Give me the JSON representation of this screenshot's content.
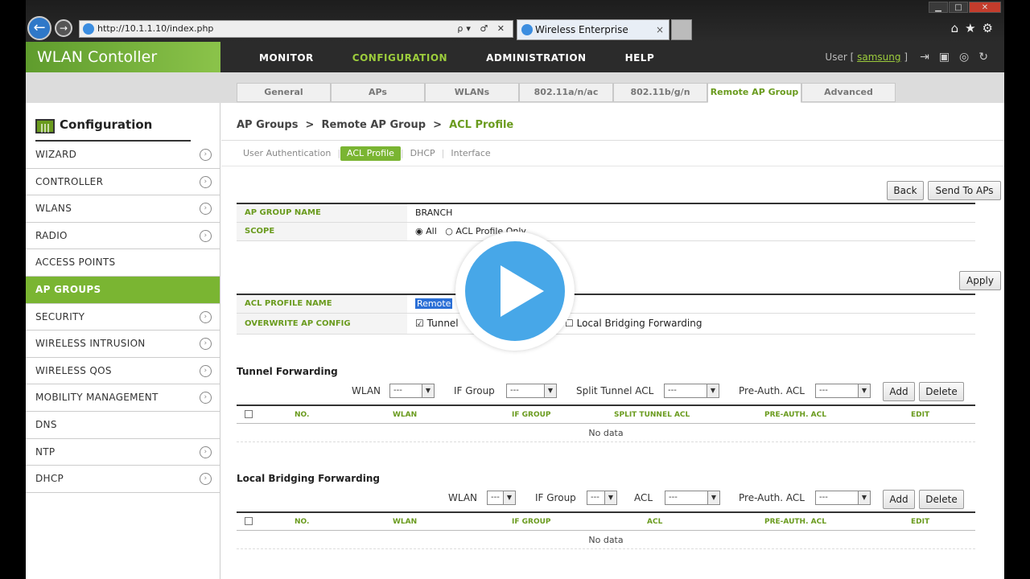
{
  "browser": {
    "url": "http://10.1.1.10/index.php",
    "tab_title": "Wireless Enterprise Manager",
    "tab_close": "×",
    "addr_controls": "ρ▾ ♂ ✕"
  },
  "app": {
    "title": "WLAN Contoller",
    "nav": [
      "MONITOR",
      "CONFIGURATION",
      "ADMINISTRATION",
      "HELP"
    ],
    "user_prefix": "User [",
    "user_name": "samsung",
    "user_suffix": "]"
  },
  "subtabs": [
    "General",
    "APs",
    "WLANs",
    "802.11a/n/ac",
    "802.11b/g/n",
    "Remote AP Group",
    "Advanced"
  ],
  "sidebar": {
    "title": "Configuration",
    "items": [
      "WIZARD",
      "CONTROLLER",
      "WLANS",
      "RADIO",
      "ACCESS POINTS",
      "AP GROUPS",
      "SECURITY",
      "WIRELESS INTRUSION",
      "WIRELESS QOS",
      "MOBILITY MANAGEMENT",
      "DNS",
      "NTP",
      "DHCP"
    ]
  },
  "breadcrumb": {
    "a": "AP Groups",
    "b": "Remote AP Group",
    "c": "ACL Profile",
    "sep": ">"
  },
  "pilltabs": [
    "User Authentication",
    "ACL Profile",
    "DHCP",
    "Interface"
  ],
  "buttons": {
    "back": "Back",
    "send": "Send To APs",
    "apply": "Apply",
    "add": "Add",
    "delete": "Delete"
  },
  "group": {
    "name_label": "AP GROUP NAME",
    "name_value": "BRANCH",
    "scope_label": "SCOPE",
    "scope_all": "All",
    "scope_acl": "ACL Profile Only"
  },
  "acl": {
    "name_label": "ACL PROFILE NAME",
    "name_value": "Remote",
    "overwrite_label": "OVERWRITE AP CONFIG",
    "tunnel": "Tunnel",
    "local": "Local Bridging Forwarding"
  },
  "tunnel": {
    "title": "Tunnel Forwarding",
    "f_wlan": "WLAN",
    "f_if": "IF Group",
    "f_split": "Split Tunnel ACL",
    "f_pre": "Pre-Auth. ACL",
    "dash": "---",
    "cols": [
      "NO.",
      "WLAN",
      "IF GROUP",
      "SPLIT TUNNEL ACL",
      "PRE-AUTH. ACL",
      "EDIT"
    ],
    "nodata": "No data"
  },
  "local": {
    "title": "Local Bridging Forwarding",
    "f_wlan": "WLAN",
    "f_if": "IF Group",
    "f_acl": "ACL",
    "f_pre": "Pre-Auth. ACL",
    "dash": "---",
    "cols": [
      "NO.",
      "WLAN",
      "IF GROUP",
      "ACL",
      "PRE-AUTH. ACL",
      "EDIT"
    ],
    "nodata": "No data"
  },
  "colors": {
    "accent": "#7ab532",
    "label_green": "#6a9b1e",
    "play": "#47a7e8"
  }
}
